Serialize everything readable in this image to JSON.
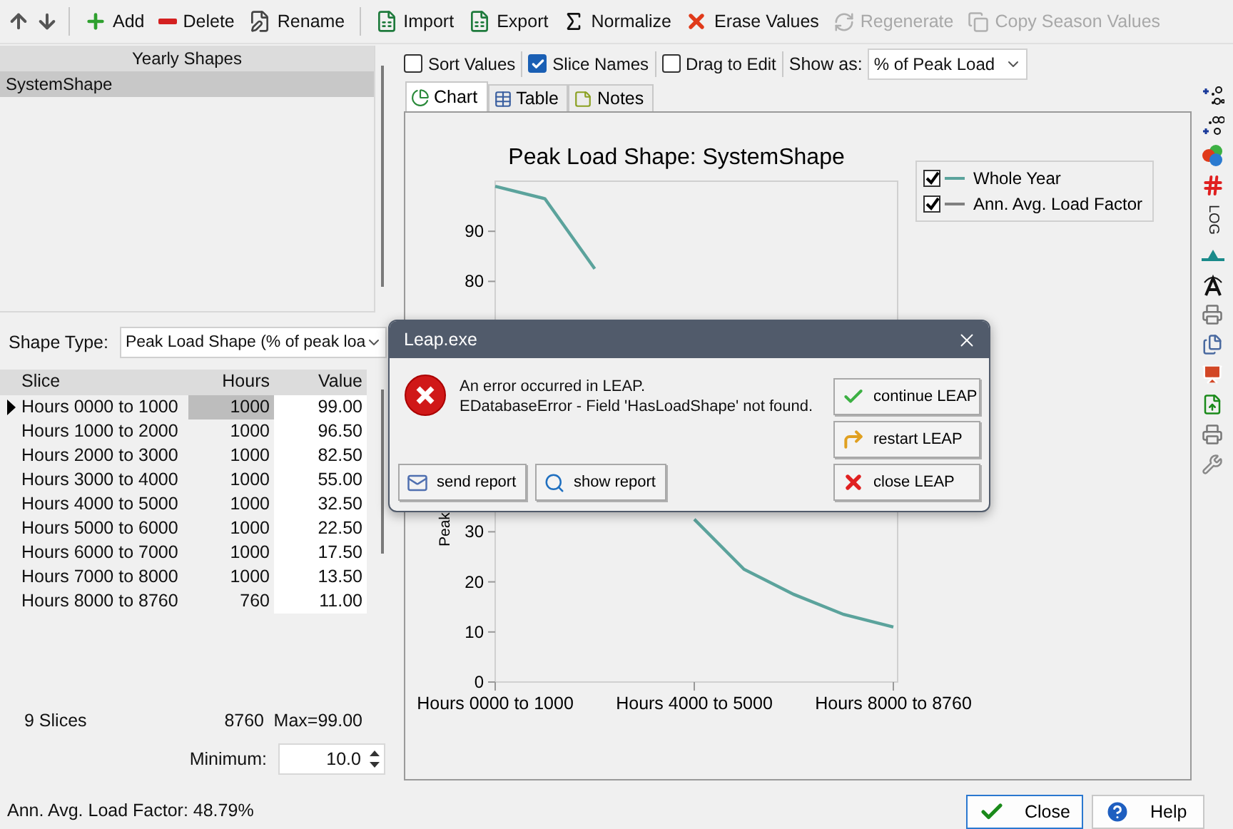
{
  "toolbar": [
    {
      "label": "Add",
      "kind": "add",
      "disabled": false
    },
    {
      "label": "Delete",
      "kind": "delete",
      "disabled": false
    },
    {
      "label": "Rename",
      "kind": "rename",
      "disabled": false
    },
    {
      "label": "Import",
      "kind": "import",
      "disabled": false
    },
    {
      "label": "Export",
      "kind": "export",
      "disabled": false
    },
    {
      "label": "Normalize",
      "kind": "normalize",
      "disabled": false
    },
    {
      "label": "Erase Values",
      "kind": "erase",
      "disabled": false
    },
    {
      "label": "Regenerate",
      "kind": "regenerate",
      "disabled": true
    },
    {
      "label": "Copy Season Values",
      "kind": "copy",
      "disabled": true
    }
  ],
  "shapes_list": {
    "header": "Yearly Shapes",
    "items": [
      {
        "label": "SystemShape",
        "selected": true
      }
    ]
  },
  "shape_type": {
    "label": "Shape Type:",
    "value": "Peak Load Shape (% of peak loa"
  },
  "table": {
    "columns": [
      "Slice",
      "Hours",
      "Value"
    ],
    "rows": [
      {
        "slice": "Hours 0000 to 1000",
        "hours": "1000",
        "value": "99.00",
        "selected": true
      },
      {
        "slice": "Hours 1000 to 2000",
        "hours": "1000",
        "value": "96.50",
        "selected": false
      },
      {
        "slice": "Hours 2000 to 3000",
        "hours": "1000",
        "value": "82.50",
        "selected": false
      },
      {
        "slice": "Hours 3000 to 4000",
        "hours": "1000",
        "value": "55.00",
        "selected": false
      },
      {
        "slice": "Hours 4000 to 5000",
        "hours": "1000",
        "value": "32.50",
        "selected": false
      },
      {
        "slice": "Hours 5000 to 6000",
        "hours": "1000",
        "value": "22.50",
        "selected": false
      },
      {
        "slice": "Hours 6000 to 7000",
        "hours": "1000",
        "value": "17.50",
        "selected": false
      },
      {
        "slice": "Hours 7000 to 8000",
        "hours": "1000",
        "value": "13.50",
        "selected": false
      },
      {
        "slice": "Hours 8000 to 8760",
        "hours": "760",
        "value": "11.00",
        "selected": false
      }
    ]
  },
  "table_footer": {
    "count": "9 Slices",
    "total_hours": "8760",
    "max": "Max=99.00"
  },
  "minimum": {
    "label": "Minimum:",
    "value": "10.0"
  },
  "options": {
    "checkboxes": [
      {
        "label": "Sort Values",
        "checked": false
      },
      {
        "label": "Slice Names",
        "checked": true
      },
      {
        "label": "Drag to Edit",
        "checked": false
      }
    ],
    "show_as_label": "Show as:",
    "show_as_value": "% of Peak Load"
  },
  "tabs": [
    {
      "label": "Chart",
      "kind": "chart",
      "selected": true
    },
    {
      "label": "Table",
      "kind": "table",
      "selected": false
    },
    {
      "label": "Notes",
      "kind": "notes",
      "selected": false
    }
  ],
  "chart": {
    "legend": [
      {
        "checked": true
      },
      {
        "label": "Ann. Avg. Load Factor",
        "checked": true,
        "color": "#808080"
      }
    ],
    "chart_data": {
      "type": "line",
      "title": "Peak Load Shape: SystemShape",
      "ylabel": "Peak",
      "categories": [
        "Hours 0000 to 1000",
        null,
        null,
        null,
        "Hours 4000 to 5000",
        null,
        null,
        null,
        "Hours 8000 to 8760"
      ],
      "series": [
        {
          "name": "Whole Year",
          "color": "#5ba39c",
          "values": [
            99,
            96.5,
            82.5,
            null,
            32.5,
            22.5,
            17.5,
            13.5,
            11
          ]
        }
      ],
      "ylim": [
        0,
        100
      ],
      "yticks": [
        0,
        10,
        20,
        30,
        80,
        90
      ]
    }
  },
  "side_toolbar": {
    "log_label": "LOG"
  },
  "dialog": {
    "title": "Leap.exe",
    "message": [
      "An error occurred in LEAP.",
      "EDatabaseError - Field 'HasLoadShape' not found."
    ],
    "actions": [
      {
        "label": "continue LEAP",
        "kind": "continue"
      },
      {
        "label": "restart LEAP",
        "kind": "restart"
      },
      {
        "label": "close LEAP",
        "kind": "close"
      }
    ],
    "report_buttons": [
      {
        "label": "send report",
        "kind": "send"
      },
      {
        "label": "show report",
        "kind": "show"
      }
    ]
  },
  "status_bar": {
    "text": "Ann. Avg. Load Factor: 48.79%"
  },
  "footer_buttons": [
    {
      "label": "Close",
      "kind": "close"
    },
    {
      "label": "Help",
      "kind": "help"
    }
  ]
}
